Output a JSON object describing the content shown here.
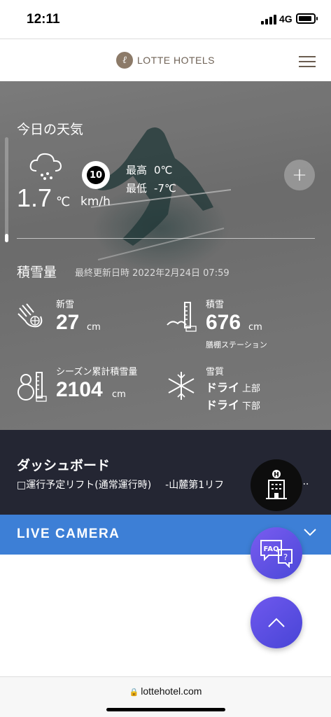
{
  "status_bar": {
    "time": "12:11",
    "network": "4G"
  },
  "header": {
    "logo_text": "LOTTE HOTELS",
    "logo_letter": "ℓ"
  },
  "weather": {
    "title": "今日の天気",
    "temperature": "1.7",
    "temp_unit": "℃",
    "wind_speed": "10",
    "wind_unit": "km/h",
    "high_label": "最高",
    "high_value": "0℃",
    "low_label": "最低",
    "low_value": "-7℃",
    "add_label": "+"
  },
  "snow": {
    "title": "積雪量",
    "updated": "最終更新日時  2022年2月24日 07:59",
    "new_snow": {
      "label": "新雪",
      "value": "27",
      "unit": "cm"
    },
    "snow_depth": {
      "label": "積雪",
      "value": "676",
      "unit": "cm",
      "sub": "膳棚ステーション"
    },
    "season_total": {
      "label": "シーズン累計積雪量",
      "value": "2104",
      "unit": "cm"
    },
    "quality": {
      "label": "雪質",
      "upper_value": "ドライ",
      "upper_label": "上部",
      "lower_value": "ドライ",
      "lower_label": "下部"
    }
  },
  "dashboard": {
    "title": "ダッシュボード",
    "lift_label": "□運行予定リフト(通常運行時)",
    "lift_name": "-山麓第1リフ",
    "more": "..."
  },
  "live_camera": {
    "label": "LIVE CAMERA"
  },
  "floating": {
    "faq_label": "FAQ",
    "hotel_badge": "H"
  },
  "bottom_bar": {
    "url": "lottehotel.com",
    "lock": "🔒"
  },
  "colors": {
    "dashboard_bg": "#242633",
    "live_camera_bg": "#3d7fd6",
    "fab_purple": "#5a4fe4",
    "logo_brown": "#8c7a68"
  },
  "icons": [
    "signal-icon",
    "battery-icon",
    "menu-icon",
    "cloud-snow-icon",
    "wind-icon",
    "plus-icon",
    "snow-hand-icon",
    "snow-gauge-icon",
    "snowman-icon",
    "snowflake-icon",
    "hotel-icon",
    "faq-icon",
    "chevron-up-icon",
    "chevron-down-icon",
    "lock-icon"
  ]
}
